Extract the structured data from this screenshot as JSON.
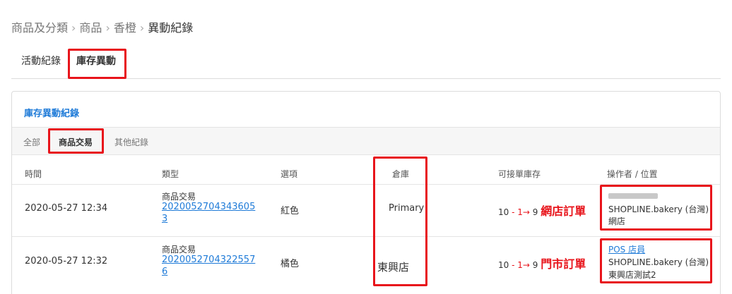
{
  "breadcrumb": [
    "商品及分類",
    "商品",
    "香橙",
    "異動紀錄"
  ],
  "breadcrumb_separator": "›",
  "tabs": [
    "活動紀錄",
    "庫存異動"
  ],
  "panel": {
    "title": "庫存異動紀錄",
    "subtabs": [
      "全部",
      "商品交易",
      "其他紀錄"
    ]
  },
  "table": {
    "headers": [
      "時間",
      "類型",
      "選項",
      "倉庫",
      "可接單庫存",
      "操作者 / 位置"
    ],
    "rows": [
      {
        "time": "2020-05-27 12:34",
        "type": "商品交易",
        "order_line1": "2020052704343605",
        "order_line2": "3",
        "option": "紅色",
        "warehouse": "Primary",
        "stock_from": "10",
        "stock_change": "- 1",
        "stock_arrow": "→",
        "stock_to": "9",
        "stock_note": "網店訂單",
        "operator": "",
        "store": "SHOPLINE.bakery (台灣)",
        "location": "網店"
      },
      {
        "time": "2020-05-27 12:32",
        "type": "商品交易",
        "order_line1": "2020052704322557",
        "order_line2": "6",
        "option": "橘色",
        "warehouse": "東興店",
        "stock_from": "10",
        "stock_change": "- 1",
        "stock_arrow": "→",
        "stock_to": "9",
        "stock_note": "門市訂單",
        "operator": "POS 店員",
        "store": "SHOPLINE.bakery (台灣)",
        "location": "東興店測試2"
      }
    ]
  },
  "colors": {
    "highlight": "#e8141b",
    "link": "#1f7bd8"
  }
}
